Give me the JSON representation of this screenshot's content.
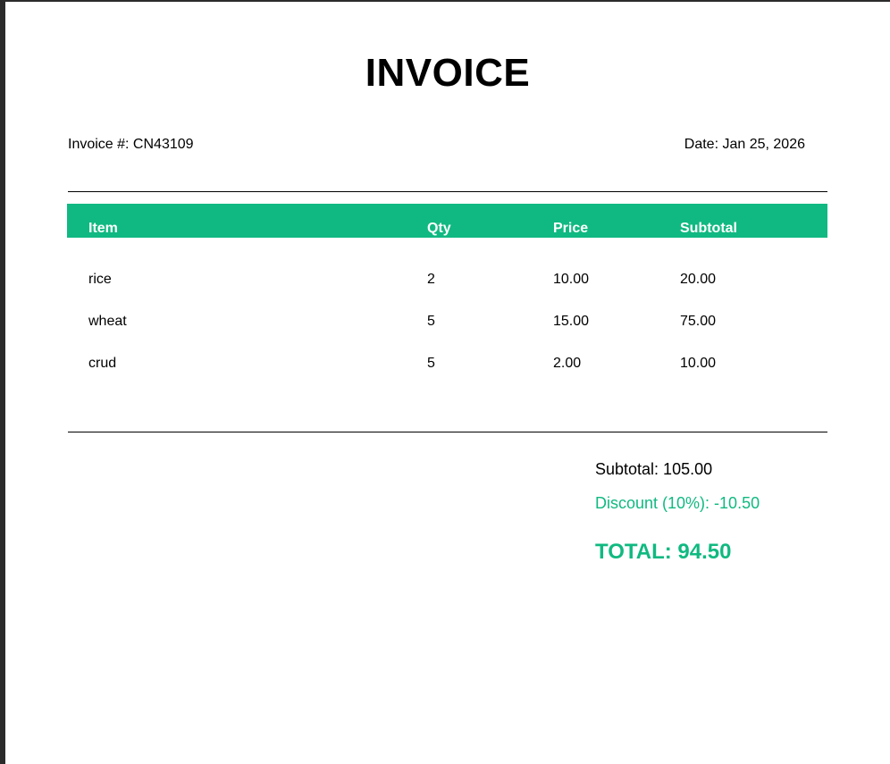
{
  "invoice": {
    "title": "INVOICE",
    "number_label": "Invoice #: CN43109",
    "date_label": "Date: Jan 25, 2026"
  },
  "table": {
    "headers": [
      "Item",
      "Qty",
      "Price",
      "Subtotal"
    ],
    "rows": [
      {
        "item": "rice",
        "qty": "2",
        "price": "10.00",
        "subtotal": "20.00"
      },
      {
        "item": "wheat",
        "qty": "5",
        "price": "15.00",
        "subtotal": "75.00"
      },
      {
        "item": "crud",
        "qty": "5",
        "price": "2.00",
        "subtotal": "10.00"
      }
    ]
  },
  "summary": {
    "subtotal": "Subtotal: 105.00",
    "discount": "Discount (10%): -10.50",
    "total": "TOTAL: 94.50"
  },
  "colors": {
    "accent": "#10b981",
    "text": "#000000",
    "page_background": "#ffffff",
    "viewer_background": "#2b2b2b"
  }
}
